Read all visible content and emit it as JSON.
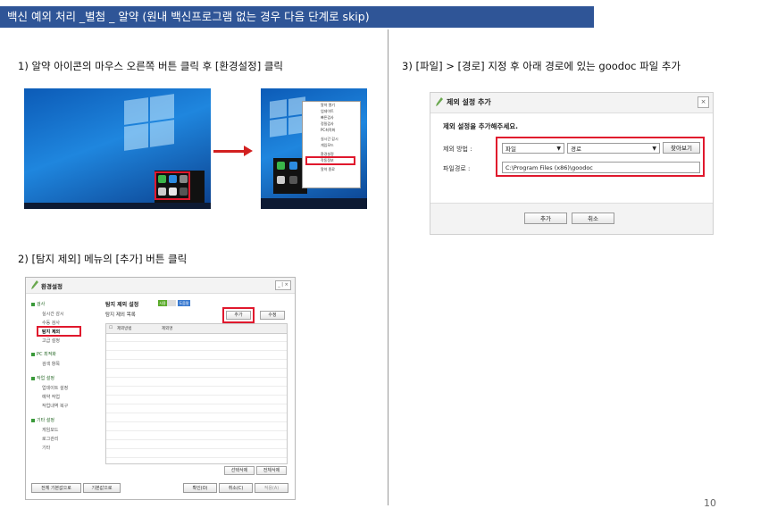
{
  "header": {
    "title": "백신 예외 처리 _별첨 _ 알약 (원내 백신프로그램 없는 경우 다음 단계로 skip)"
  },
  "steps": [
    {
      "label": "1) 알약 아이콘의 마우스 오른쪽 버튼 클릭 후 [환경설정] 클릭"
    },
    {
      "label": "2) [탐지 제외] 메뉴의 [추가] 버튼 클릭"
    },
    {
      "label": "3) [파일] > [경로] 지정 후 아래 경로에 있는 goodoc 파일 추가"
    }
  ],
  "step1": {
    "context_menu": [
      "알약 열기",
      "업데이트",
      "빠른검사",
      "정밀검사",
      "PC최적화",
      "",
      "실시간 감시",
      "게임모드",
      "",
      "환경설정",
      "작동정보",
      "",
      "알약 종료"
    ],
    "highlight_item": "환경설정"
  },
  "colors": {
    "title_bar": "#2f5597",
    "highlight": "#e0182d",
    "brand_green": "#3a9a3a"
  },
  "dialog": {
    "title": "제외 설정 추가",
    "close": "×",
    "instruction": "제외 설정을 추가해주세요.",
    "method_label": "제외 방법 :",
    "method_value": "파일",
    "path_type_value": "경로",
    "browse_button": "찾아보기",
    "filepath_label": "파일경로 :",
    "filepath_value": "C:\\Program Files (x86)\\goodoc",
    "add_button": "추가",
    "cancel_button": "취소"
  },
  "settings": {
    "title": "환경설정",
    "window_controls": "_ | ×",
    "sidebar": [
      {
        "label": "검사",
        "group": true
      },
      {
        "label": "실시간 감시",
        "group": false
      },
      {
        "label": "수동 검사",
        "group": false
      },
      {
        "label": "탐지 제외",
        "group": false,
        "active": true
      },
      {
        "label": "고급 설정",
        "group": false
      },
      {
        "label": "PC 최적화",
        "group": true
      },
      {
        "label": "검색 항목",
        "group": false
      },
      {
        "label": "작업 설정",
        "group": true
      },
      {
        "label": "업데이트 설정",
        "group": false
      },
      {
        "label": "예약 작업",
        "group": false
      },
      {
        "label": "작업내역 복구",
        "group": false
      },
      {
        "label": "기타 설정",
        "group": true
      },
      {
        "label": "게임모드",
        "group": false
      },
      {
        "label": "로그관리",
        "group": false
      },
      {
        "label": "기타",
        "group": false
      }
    ],
    "content_title": "탐지 제외 설정",
    "toggle_on": "사용",
    "toggle_label": "도움말",
    "content_subtitle": "탐지 제외 목록",
    "add_button": "추가",
    "edit_button": "수정",
    "grid_headers": [
      "제외방법",
      "제외명"
    ],
    "list_buttons": [
      "선택삭제",
      "전체삭제"
    ],
    "footer_left": [
      "전체 기본값으로",
      "기본값으로"
    ],
    "footer_right": [
      "확인(O)",
      "취소(C)",
      "적용(A)"
    ]
  },
  "page": {
    "number": "10"
  }
}
